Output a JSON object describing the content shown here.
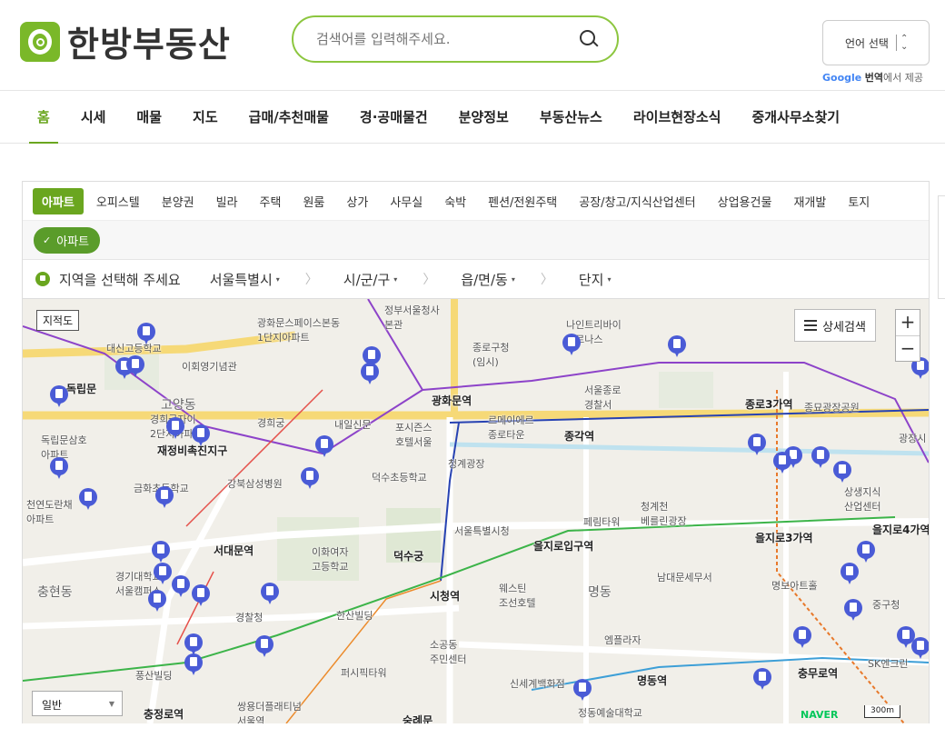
{
  "header": {
    "logo_text": "한방부동산",
    "search_placeholder": "검색어를 입력해주세요.",
    "lang_label": "언어 선택",
    "google_label": "Google",
    "translate_label": "번역",
    "translate_suffix": "에서 제공"
  },
  "nav": {
    "items": [
      "홈",
      "시세",
      "매물",
      "지도",
      "급매/추천매물",
      "경·공매물건",
      "분양정보",
      "부동산뉴스",
      "라이브현장소식",
      "중개사무소찾기"
    ]
  },
  "panel": {
    "tabs": [
      "아파트",
      "오피스텔",
      "분양권",
      "빌라",
      "주택",
      "원룸",
      "상가",
      "사무실",
      "숙박",
      "펜션/전원주택",
      "공장/창고/지식산업센터",
      "상업용건물",
      "재개발",
      "토지"
    ],
    "chip": "아파트",
    "region_prompt": "지역을 선택해 주세요",
    "selects": [
      "서울특별시",
      "시/군/구",
      "읍/면/동",
      "단지"
    ]
  },
  "map": {
    "jijeok_label": "지적도",
    "detail_label": "상세검색",
    "zoom_in": "+",
    "zoom_out": "−",
    "map_type": "일반",
    "naver": "NAVER",
    "scale": "300m",
    "labels": {
      "l1": "광화문스페이스본동\n1단지아파트",
      "l2": "이회영기념관",
      "l3": "독립문",
      "l4": "경희궁",
      "l5": "내일신문",
      "l6": "광화문역",
      "l7": "종로구청\n(임시)",
      "l8": "서울종로\n경찰서",
      "l9": "종각역",
      "l10": "종로3가역",
      "l11": "종묘광장공원",
      "l12": "청계광장",
      "l13": "재정비촉진지구",
      "l14": "강북삼성병원",
      "l15": "덕수초등학교",
      "l16": "서대문역",
      "l17": "이화여자\n고등학교",
      "l18": "덕수궁",
      "l19": "서울특별시청",
      "l20": "을지로입구역",
      "l21": "을지로3가역",
      "l22": "을지로4가역",
      "l23": "시청역",
      "l24": "웨스틴\n조선호텔",
      "l25": "명동",
      "l26": "남대문세무서",
      "l27": "경찰청",
      "l28": "한산빌딩",
      "l29": "충현동",
      "l30": "소공동\n주민센터",
      "l31": "엠플라자",
      "l32": "명동역",
      "l33": "충무로역",
      "l34": "퍼시픽타워",
      "l35": "신세계백화점",
      "l36": "쌍용더플래티넘\n서울역",
      "l37": "충정로역",
      "l38": "숭례문",
      "l39": "중구청",
      "l40": "SK엔크린",
      "l41": "명보아트홀",
      "l42": "상생지식\n산업센터",
      "l43": "청계천\n베를린광장",
      "l44": "페림타워",
      "l45": "르메이에르\n종로타운",
      "l46": "포시즌스\n호텔서울",
      "l47": "천연도란채\n아파트",
      "l48": "독립문삼호\n아파트",
      "l49": "금화초등학교",
      "l50": "경기대학교\n서울캠퍼스",
      "l51": "풍산빌딩",
      "l52": "정동예술대학교",
      "l53": "대신고등학교",
      "l54": "나인트리바이\n파르나스",
      "l55": "정부서울청사\n본관",
      "l56": "고양동",
      "l57": "경희궁자이\n2단지아파트",
      "l58": "광장시"
    }
  },
  "colors": {
    "accent": "#6aa61f",
    "marker": "#4a5bd6"
  }
}
